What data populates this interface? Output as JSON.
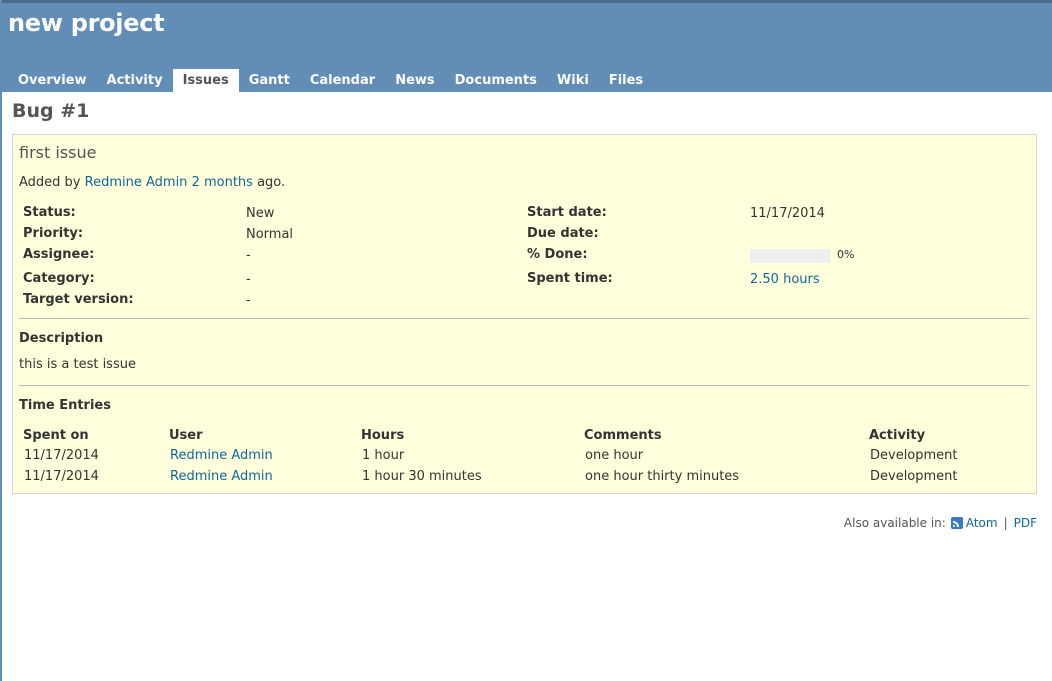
{
  "project": {
    "title": "new project"
  },
  "menu": {
    "tabs": [
      {
        "label": "Overview",
        "selected": false
      },
      {
        "label": "Activity",
        "selected": false
      },
      {
        "label": "Issues",
        "selected": true
      },
      {
        "label": "Gantt",
        "selected": false
      },
      {
        "label": "Calendar",
        "selected": false
      },
      {
        "label": "News",
        "selected": false
      },
      {
        "label": "Documents",
        "selected": false
      },
      {
        "label": "Wiki",
        "selected": false
      },
      {
        "label": "Files",
        "selected": false
      }
    ]
  },
  "issue": {
    "heading": "Bug #1",
    "subject": "first issue",
    "author": {
      "prefix": "Added by",
      "name": "Redmine Admin",
      "time": "2 months",
      "suffix": "ago."
    },
    "attributes": {
      "status": {
        "label": "Status:",
        "value": "New"
      },
      "priority": {
        "label": "Priority:",
        "value": "Normal"
      },
      "assignee": {
        "label": "Assignee:",
        "value": "-"
      },
      "category": {
        "label": "Category:",
        "value": "-"
      },
      "target_version": {
        "label": "Target version:",
        "value": "-"
      },
      "start_date": {
        "label": "Start date:",
        "value": "11/17/2014"
      },
      "due_date": {
        "label": "Due date:",
        "value": ""
      },
      "done": {
        "label": "% Done:",
        "value": "0%",
        "fraction": 0
      },
      "spent_time": {
        "label": "Spent time:",
        "value": "2.50 hours"
      }
    },
    "description": {
      "title": "Description",
      "text": "this is a test issue"
    },
    "time_entries": {
      "title": "Time Entries",
      "columns": [
        "Spent on",
        "User",
        "Hours",
        "Comments",
        "Activity"
      ],
      "rows": [
        {
          "spent_on": "11/17/2014",
          "user": "Redmine Admin",
          "hours": "1 hour",
          "comments": "one hour",
          "activity": "Development"
        },
        {
          "spent_on": "11/17/2014",
          "user": "Redmine Admin",
          "hours": "1 hour 30 minutes",
          "comments": "one hour thirty minutes",
          "activity": "Development"
        }
      ]
    }
  },
  "other_formats": {
    "label": "Also available in:",
    "atom": "Atom",
    "pdf": "PDF",
    "separator": "|"
  },
  "colors": {
    "header": "#628db6",
    "issue_background": "#ffffdd",
    "link": "#116699"
  },
  "icons": {
    "atom": "rss-feed-icon"
  }
}
